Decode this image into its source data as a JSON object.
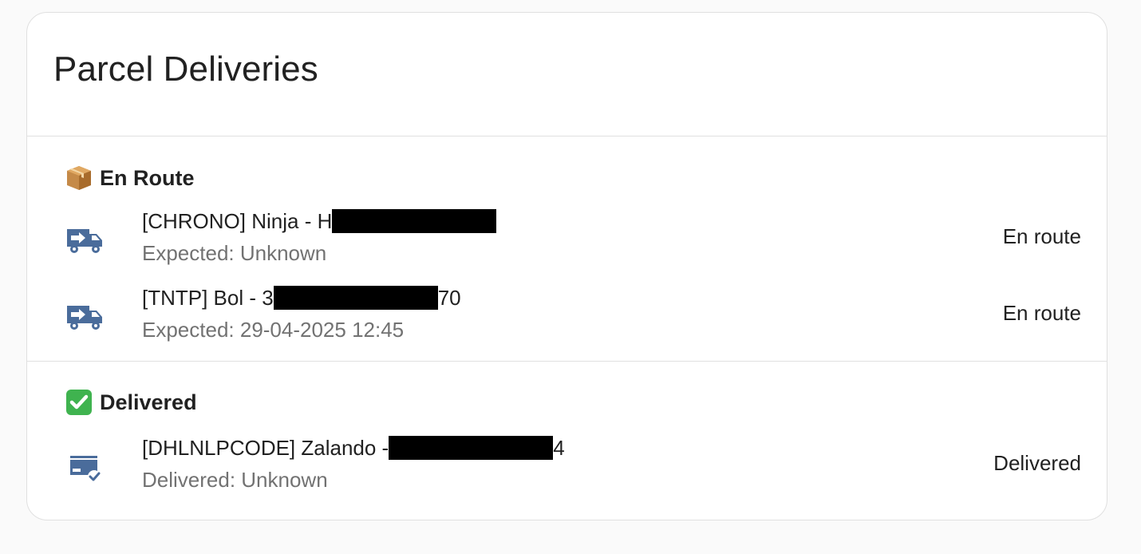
{
  "card": {
    "title": "Parcel Deliveries"
  },
  "sections": {
    "en_route": {
      "title": "En Route",
      "emoji_icon": "package-icon",
      "items": [
        {
          "name_prefix": "[CHRONO] Ninja - H",
          "name_suffix": "",
          "secondary": "Expected: Unknown",
          "state": "En route",
          "icon": "truck-fast-icon"
        },
        {
          "name_prefix": "[TNTP] Bol - 3",
          "name_suffix": "70",
          "secondary": "Expected: 29-04-2025 12:45",
          "state": "En route",
          "icon": "truck-fast-icon"
        }
      ]
    },
    "delivered": {
      "title": "Delivered",
      "emoji_icon": "check-mark-button-icon",
      "items": [
        {
          "name_prefix": "[DHLNLPCODE] Zalando - ",
          "name_suffix": "4",
          "secondary": "Delivered: Unknown",
          "state": "Delivered",
          "icon": "package-check-icon"
        }
      ]
    }
  },
  "colors": {
    "icon": "#4a6c9b",
    "divider": "#e0e0e0",
    "secondary_text": "#727272",
    "check_emoji": "#3fb34f",
    "box_emoji": "#a0682c"
  }
}
